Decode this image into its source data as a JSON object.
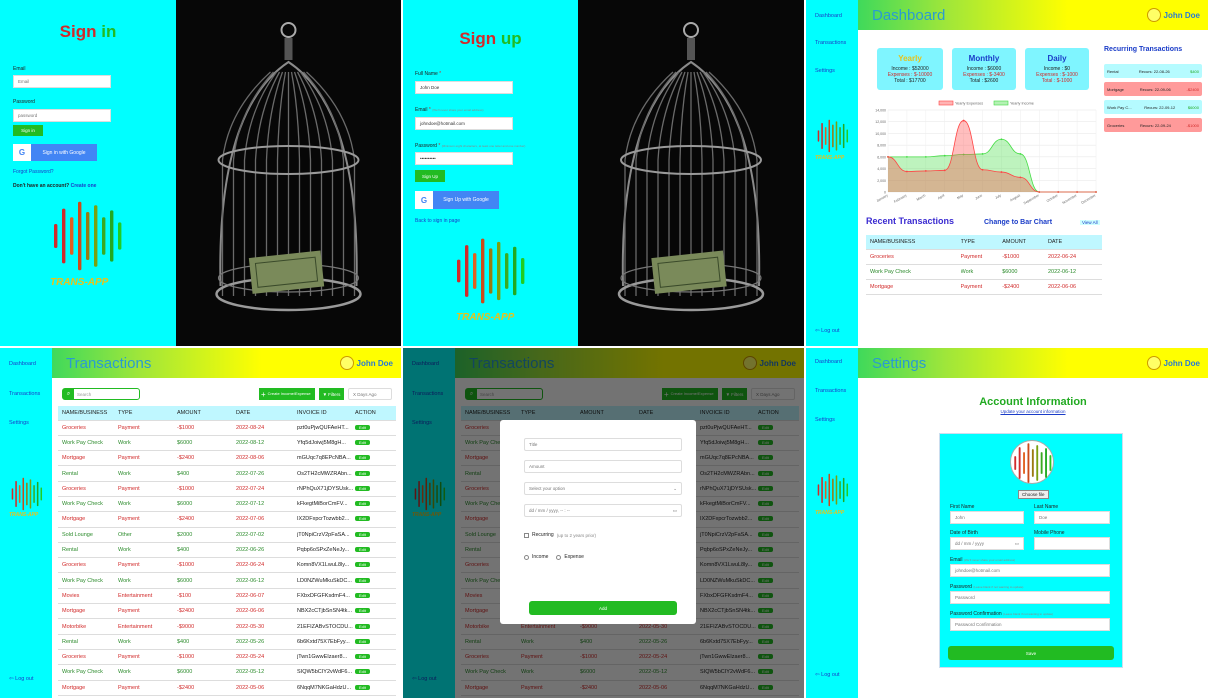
{
  "logo_text": "TRANS-APP",
  "signin": {
    "title_a": "Sign",
    "title_b": "in",
    "email_label": "Email",
    "email_placeholder": "Email",
    "password_label": "Password",
    "password_placeholder": "password",
    "submit": "Sign in",
    "google": "Sign in with Google",
    "forgot": "Forgot Password?",
    "no_account": "Don't have an account?",
    "create": "Create one"
  },
  "signup": {
    "title_a": "Sign",
    "title_b": "up",
    "fullname_label": "Full Name",
    "fullname_value": "John Doe",
    "email_label": "Email",
    "email_hint": "(We'll never share your email address)",
    "email_value": "johndoe@hotmail.com",
    "password_label": "Password",
    "password_hint": "(Minimum eight characters, at least one letter and one number)",
    "password_value": "••••••••••",
    "submit": "Sign Up",
    "google": "Sign Up with Google",
    "back": "Back to sign in page"
  },
  "nav": {
    "dashboard": "Dashboard",
    "transactions": "Transactions",
    "settings": "Settings",
    "logout": "Log out"
  },
  "user": {
    "name": "John Doe"
  },
  "dashboard": {
    "title": "Dashboard",
    "cards": [
      {
        "title": "Yearly",
        "income": "Income : $52000",
        "expenses": "Expenses : $-10000",
        "total": "Total : $17700"
      },
      {
        "title": "Monthly",
        "income": "Income : $6000",
        "expenses": "Expenses : $-3400",
        "total": "Total : $2600"
      },
      {
        "title": "Daily",
        "income": "Income : $0",
        "expenses": "Expenses : $-1000",
        "total": "Total : $-1000"
      }
    ],
    "recurring_title": "Recurring Transactions",
    "recurring": [
      {
        "name": "Rental",
        "recurs": "Recurs: 22-08-26",
        "amount": "$400",
        "type": "income"
      },
      {
        "name": "Mortgage",
        "recurs": "Recurs: 22-09-06",
        "amount": "-$2400",
        "type": "expense"
      },
      {
        "name": "Work Pay C...",
        "recurs": "Recurs: 22-09-12",
        "amount": "$6000",
        "type": "income"
      },
      {
        "name": "Groceries",
        "recurs": "Recurs: 22-09-24",
        "amount": "-$1000",
        "type": "expense"
      }
    ],
    "recent_title": "Recent Transactions",
    "change_chart": "Change to Bar Chart",
    "view_all": "View All",
    "recent_headers": [
      "NAME/BUSINESS",
      "TYPE",
      "AMOUNT",
      "DATE"
    ],
    "recent_rows": [
      {
        "name": "Groceries",
        "type": "Payment",
        "amount": "-$1000",
        "date": "2022-06-24",
        "cls": "pay"
      },
      {
        "name": "Work Pay Check",
        "type": "Work",
        "amount": "$6000",
        "date": "2022-06-12",
        "cls": "work"
      },
      {
        "name": "Mortgage",
        "type": "Payment",
        "amount": "-$2400",
        "date": "2022-06-06",
        "cls": "pay"
      }
    ]
  },
  "chart_data": {
    "type": "area",
    "categories": [
      "January",
      "February",
      "March",
      "April",
      "May",
      "June",
      "July",
      "August",
      "September",
      "October",
      "November",
      "December"
    ],
    "series": [
      {
        "name": "Yearly Expenses",
        "color": "#ff4444",
        "values": [
          6000,
          3500,
          3600,
          3700,
          12200,
          3800,
          3400,
          2500,
          0,
          0,
          0,
          0
        ]
      },
      {
        "name": "Yearly Income",
        "color": "#44dd44",
        "values": [
          6000,
          6000,
          6000,
          6200,
          6400,
          6500,
          9000,
          6500,
          0,
          0,
          0,
          0
        ]
      }
    ],
    "yticks": [
      "14,000",
      "12,000",
      "10,000",
      "8,000",
      "6,000",
      "4,000",
      "2,000",
      "0"
    ],
    "ylim": [
      0,
      14000
    ],
    "legend": "top"
  },
  "transactions": {
    "title": "Transactions",
    "search_placeholder": "Search",
    "create": "Create Income/Expense",
    "filters": "Filters",
    "days_placeholder": "X Days Ago",
    "headers": [
      "NAME/BUSINESS",
      "TYPE",
      "AMOUNT",
      "DATE",
      "INVOICE ID",
      "ACTION"
    ],
    "edit": "Edit",
    "rows": [
      {
        "name": "Groceries",
        "type": "Payment",
        "amount": "-$1000",
        "date": "2022-08-24",
        "invoice": "pzt0uPjwQUFAeHT...",
        "cls": "pay"
      },
      {
        "name": "Work Pay Check",
        "type": "Work",
        "amount": "$6000",
        "date": "2022-08-12",
        "invoice": "Yfq5dJoiwj5M8gH...",
        "cls": "work"
      },
      {
        "name": "Mortgage",
        "type": "Payment",
        "amount": "-$2400",
        "date": "2022-08-06",
        "invoice": "mGUqc7q8EPcNBA...",
        "cls": "pay"
      },
      {
        "name": "Rental",
        "type": "Work",
        "amount": "$400",
        "date": "2022-07-26",
        "invoice": "Os2TH2cMWZRAbn...",
        "cls": "work"
      },
      {
        "name": "Groceries",
        "type": "Payment",
        "amount": "-$1000",
        "date": "2022-07-24",
        "invoice": "rNPhQuX71jDYSUsk...",
        "cls": "pay"
      },
      {
        "name": "Work Pay Check",
        "type": "Work",
        "amount": "$6000",
        "date": "2022-07-12",
        "invoice": "kFkegtMiBorCmFV...",
        "cls": "work"
      },
      {
        "name": "Mortgage",
        "type": "Payment",
        "amount": "-$2400",
        "date": "2022-07-06",
        "invoice": "IX2DFxpcrTozwbb2...",
        "cls": "pay"
      },
      {
        "name": "Sold Lounge",
        "type": "Other",
        "amount": "$2000",
        "date": "2022-07-02",
        "invoice": "jT0NpiCrzV2pFaSA...",
        "cls": "oth"
      },
      {
        "name": "Rental",
        "type": "Work",
        "amount": "$400",
        "date": "2022-06-26",
        "invoice": "Pqbp6oSPxZeNeJy...",
        "cls": "work"
      },
      {
        "name": "Groceries",
        "type": "Payment",
        "amount": "-$1000",
        "date": "2022-06-24",
        "invoice": "Komn8VX1LwuL8ly...",
        "cls": "pay"
      },
      {
        "name": "Work Pay Check",
        "type": "Work",
        "amount": "$6000",
        "date": "2022-06-12",
        "invoice": "LD0NZWuMkuSkDC...",
        "cls": "work"
      },
      {
        "name": "Movies",
        "type": "Entertainment",
        "amount": "-$100",
        "date": "2022-06-07",
        "invoice": "FXbxDFGFKsdmF4...",
        "cls": "pay"
      },
      {
        "name": "Mortgage",
        "type": "Payment",
        "amount": "-$2400",
        "date": "2022-06-06",
        "invoice": "NBX2cCTjbSnSN4tk...",
        "cls": "pay"
      },
      {
        "name": "Motorbike",
        "type": "Entertainment",
        "amount": "-$9000",
        "date": "2022-05-30",
        "invoice": "21EFIZABvSTOCDU...",
        "cls": "pay"
      },
      {
        "name": "Rental",
        "type": "Work",
        "amount": "$400",
        "date": "2022-05-26",
        "invoice": "6b6Kxtd75X7EbFyy...",
        "cls": "work"
      },
      {
        "name": "Groceries",
        "type": "Payment",
        "amount": "-$1000",
        "date": "2022-05-24",
        "invoice": "jTwn1GwwEIzaer8...",
        "cls": "pay"
      },
      {
        "name": "Work Pay Check",
        "type": "Work",
        "amount": "$6000",
        "date": "2022-05-12",
        "invoice": "SIQW5bCIY2vWdF6...",
        "cls": "work"
      },
      {
        "name": "Mortgage",
        "type": "Payment",
        "amount": "-$2400",
        "date": "2022-05-06",
        "invoice": "6NqqM7NKGaHdzU...",
        "cls": "pay"
      }
    ]
  },
  "modal": {
    "title_placeholder": "Title",
    "amount_placeholder": "Amount",
    "select_option": "Select your option",
    "date_value": "dd / mm / yyyy, -- : --",
    "recurring_label": "Recurring",
    "recurring_hint": "(up to 2 years prior)",
    "income": "Income",
    "expense": "Expense",
    "add": "Add"
  },
  "settings": {
    "title": "Settings",
    "account_title": "Account Information",
    "account_sub": "Update your account information",
    "choose_file": "Choose file",
    "first_label": "First Name",
    "first_ph": "John",
    "last_label": "Last Name",
    "last_ph": "Doe",
    "dob_label": "Date of Birth",
    "dob_ph": "dd / mm / yyyy",
    "phone_label": "Mobile Phone",
    "email_label": "Email",
    "email_hint": "(We'll never share your email address)",
    "email_ph": "johndoe@hotmail.com",
    "password_label": "Password",
    "password_hint": "(Leave blank if not wanting to update)",
    "password_ph": "Password",
    "confirm_label": "Password Confirmation",
    "confirm_hint": "(Leave blank if not wanting to update)",
    "confirm_ph": "Password Confirmation",
    "save": "Save"
  }
}
